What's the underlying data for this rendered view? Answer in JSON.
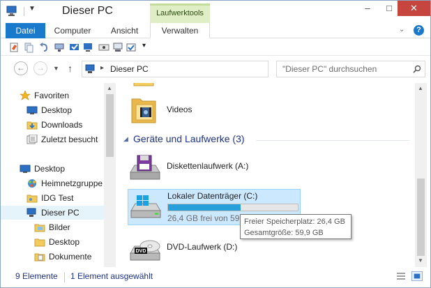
{
  "window": {
    "title": "Dieser PC",
    "context_tab_header": "Laufwerktools",
    "controls": {
      "minimize": "–",
      "maximize": "□",
      "close": "✕"
    }
  },
  "ribbon": {
    "tabs": [
      {
        "label": "Datei"
      },
      {
        "label": "Computer"
      },
      {
        "label": "Ansicht"
      },
      {
        "label": "Verwalten"
      }
    ],
    "help": "?"
  },
  "navigation": {
    "back": "←",
    "forward": "→",
    "up": "↑",
    "address": "Dieser PC",
    "search_placeholder": "\"Dieser PC\" durchsuchen"
  },
  "sidebar": {
    "items": [
      {
        "label": "Favoriten",
        "icon": "star-icon"
      },
      {
        "label": "Desktop",
        "icon": "desktop-icon"
      },
      {
        "label": "Downloads",
        "icon": "downloads-folder-icon"
      },
      {
        "label": "Zuletzt besucht",
        "icon": "recent-places-icon"
      },
      {
        "label": "Desktop",
        "icon": "desktop-icon"
      },
      {
        "label": "Heimnetzgruppe",
        "icon": "homegroup-icon"
      },
      {
        "label": "IDG Test",
        "icon": "user-folder-icon"
      },
      {
        "label": "Dieser PC",
        "icon": "computer-icon"
      },
      {
        "label": "Bilder",
        "icon": "pictures-folder-icon"
      },
      {
        "label": "Desktop",
        "icon": "folder-icon"
      },
      {
        "label": "Dokumente",
        "icon": "documents-folder-icon"
      }
    ]
  },
  "content": {
    "folder_item": {
      "label": "Videos"
    },
    "group_header": "Geräte und Laufwerke (3)",
    "drives": [
      {
        "label": "Diskettenlaufwerk (A:)",
        "icon": "floppy-drive-icon"
      },
      {
        "label": "Lokaler Datenträger (C:)",
        "icon": "windows-drive-icon",
        "free_text": "26,4 GB frei von 59,9 GB",
        "used_fraction": 0.56
      },
      {
        "label": "DVD-Laufwerk (D:)",
        "icon": "dvd-drive-icon"
      }
    ],
    "tooltip": {
      "line1": "Freier Speicherplatz: 26,4 GB",
      "line2": "Gesamtgröße: 59,9 GB"
    }
  },
  "statusbar": {
    "count": "9 Elemente",
    "selection": "1 Element ausgewählt"
  },
  "colors": {
    "accent": "#1979ca",
    "drive_bar": "#26a0da",
    "selection": "#cce8ff",
    "group_header": "#1e3287"
  }
}
